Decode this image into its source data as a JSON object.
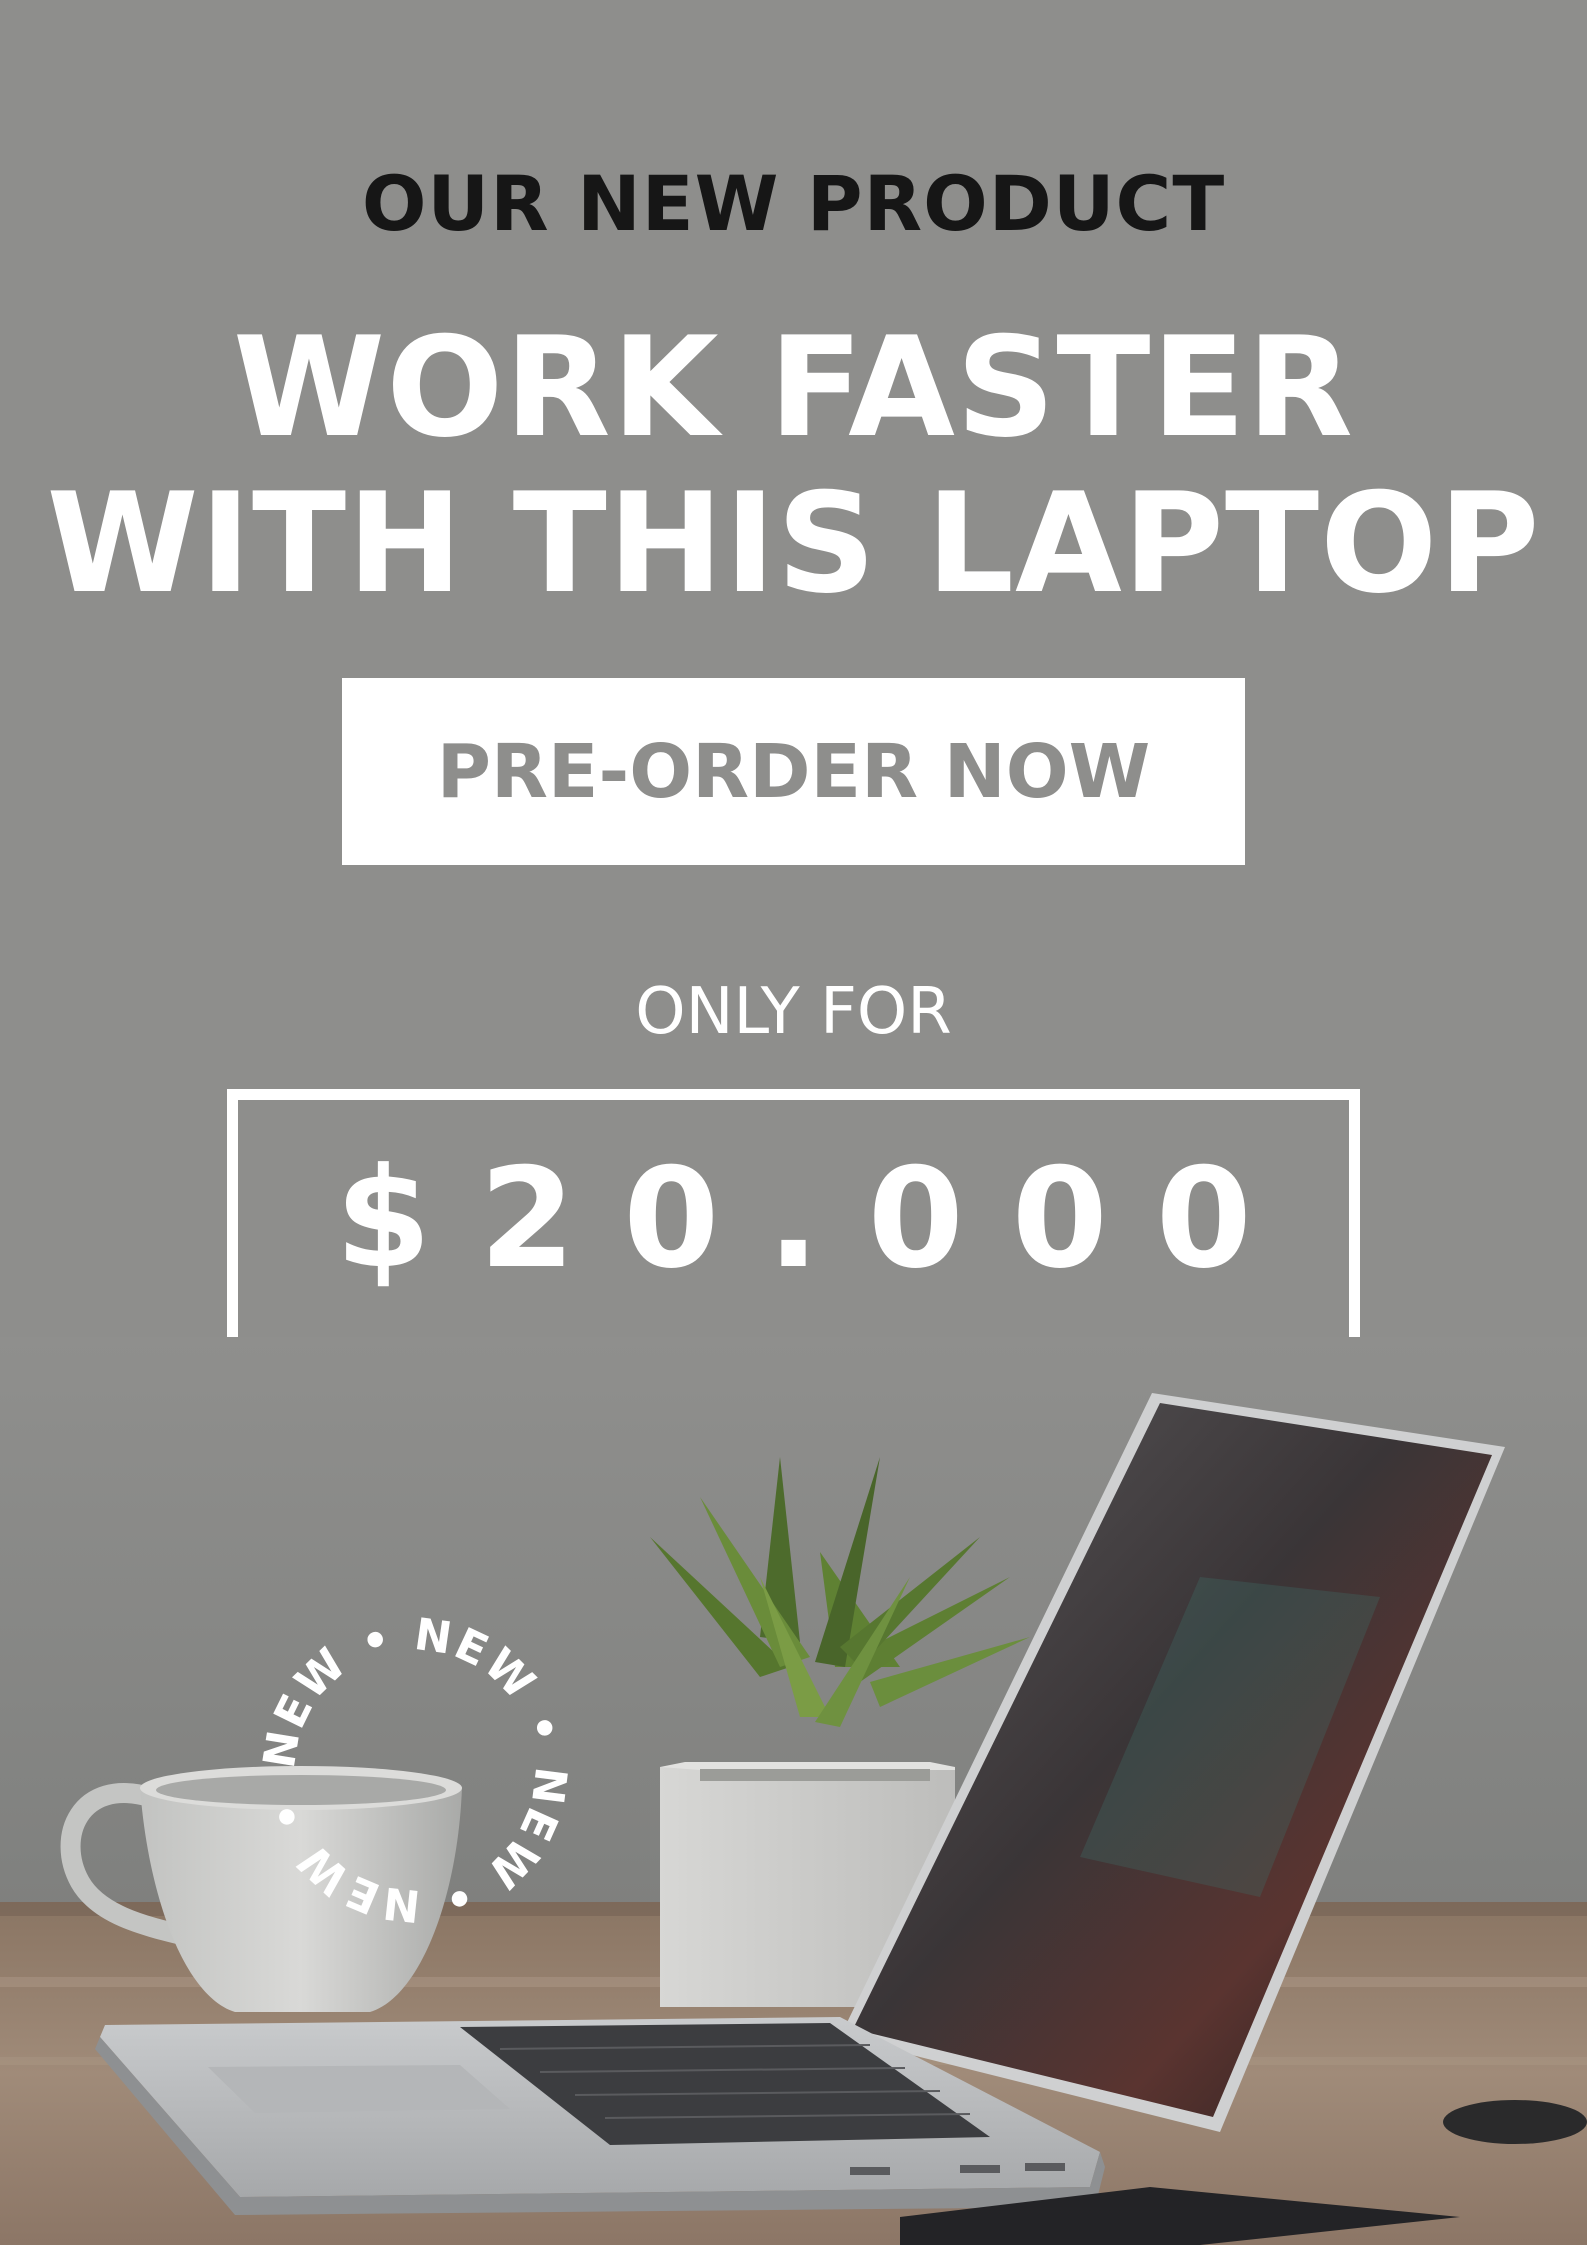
{
  "poster": {
    "eyebrow": "OUR NEW PRODUCT",
    "headline_line1": "WORK FASTER",
    "headline_line2": "WITH THIS LAPTOP",
    "cta_label": "PRE-ORDER NOW",
    "only_for": "ONLY FOR",
    "price": "$20.000"
  },
  "badge": {
    "text": "NEW • NEW • NEW • NEW • NEW • "
  },
  "colors": {
    "background": "#8e8e8c",
    "eyebrow": "#161616",
    "white": "#ffffff"
  }
}
